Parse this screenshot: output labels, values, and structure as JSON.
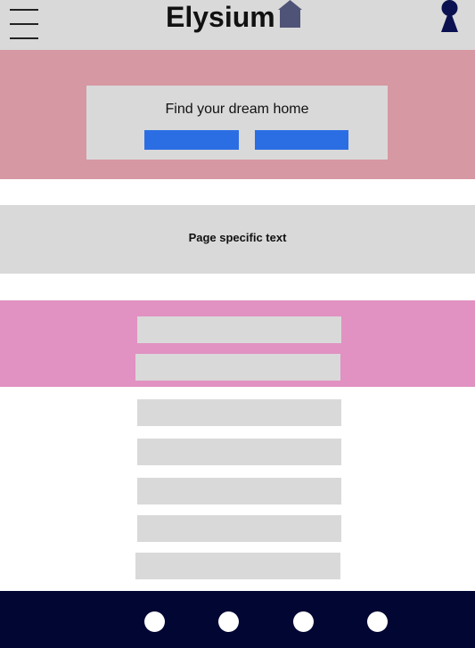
{
  "header": {
    "brand": "Elysium",
    "menu_icon": "hamburger-menu-icon",
    "logo_icon": "house-icon",
    "account_icon": "keyhole-user-icon"
  },
  "hero": {
    "title": "Find your dream home"
  },
  "content": {
    "page_text": "Page specific text"
  },
  "colors": {
    "header_bg": "#d9d9d9",
    "hero_bg": "#d698a2",
    "accent_button": "#2b6ee4",
    "pink_band": "#e191c2",
    "placeholder_gray": "#d9d9d9",
    "footer_bg": "#020633",
    "icon_navy": "#0b1150",
    "house_color": "#4f5377"
  }
}
